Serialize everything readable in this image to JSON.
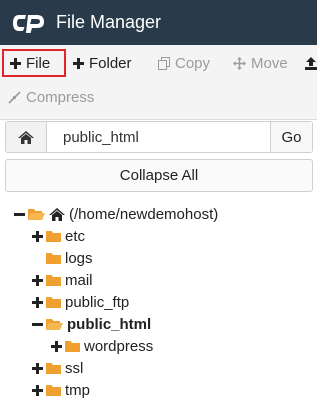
{
  "header": {
    "title": "File Manager",
    "background": "#293a4a"
  },
  "toolbar": {
    "file_label": "File",
    "folder_label": "Folder",
    "copy_label": "Copy",
    "move_label": "Move",
    "compress_label": "Compress",
    "highlight_color": "#e0262b"
  },
  "path_bar": {
    "value": "public_html",
    "go_label": "Go"
  },
  "collapse_label": "Collapse All",
  "tree": {
    "root_label": "(/home/newdemohost)",
    "items": [
      {
        "label": "etc",
        "toggle": "plus"
      },
      {
        "label": "logs",
        "toggle": "none"
      },
      {
        "label": "mail",
        "toggle": "plus"
      },
      {
        "label": "public_ftp",
        "toggle": "plus"
      },
      {
        "label": "public_html",
        "toggle": "minus",
        "selected": true
      },
      {
        "label": "wordpress",
        "toggle": "plus"
      },
      {
        "label": "ssl",
        "toggle": "plus"
      },
      {
        "label": "tmp",
        "toggle": "plus"
      }
    ],
    "folder_color": "#f0a030"
  }
}
